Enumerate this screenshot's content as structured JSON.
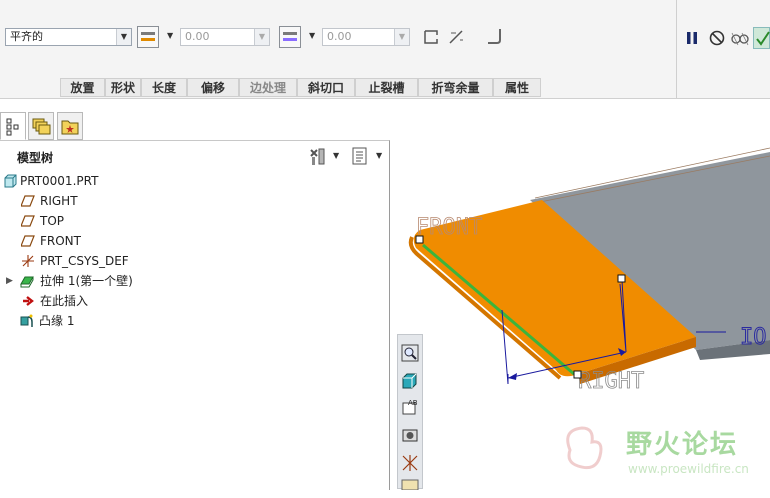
{
  "dashboard": {
    "alignment_select": "平齐的",
    "offset_value_1": "0.00",
    "offset_value_2": "0.00",
    "tabs": [
      "放置",
      "形状",
      "长度",
      "偏移",
      "边处理",
      "斜切口",
      "止裂槽",
      "折弯余量",
      "属性"
    ],
    "right_icons": [
      "pause-icon",
      "stop-icon",
      "glasses-preview-icon",
      "verify-icon"
    ]
  },
  "left_panel": {
    "tabs": [
      "model-tree-icon",
      "layers-icon",
      "favorites-folder-icon"
    ],
    "title": "模型树",
    "tree": [
      {
        "label": "PRT0001.PRT",
        "icon": "part-icon"
      },
      {
        "label": "RIGHT",
        "icon": "datum-plane-icon"
      },
      {
        "label": "TOP",
        "icon": "datum-plane-icon"
      },
      {
        "label": "FRONT",
        "icon": "datum-plane-icon"
      },
      {
        "label": "PRT_CSYS_DEF",
        "icon": "csys-icon"
      },
      {
        "label": "拉伸 1(第一个壁)",
        "icon": "extrude-icon"
      },
      {
        "label": "在此插入",
        "icon": "insert-arrow-icon"
      },
      {
        "label": "凸缘 1",
        "icon": "flange-icon"
      }
    ]
  },
  "graphics": {
    "labels": {
      "front": "FRONT",
      "right": "RIGHT",
      "top_partial": "IO"
    },
    "colors": {
      "preview": "#f08c00",
      "wall": "#8f969d",
      "edge": "#3cb43c",
      "csys": "#1a1a9e"
    }
  },
  "view_toolbar": [
    "zoom-icon",
    "shaded-view-icon",
    "named-view-icon",
    "render-icon",
    "datum-display-icon",
    "more-icon"
  ],
  "watermark": {
    "title": "野火论坛",
    "url": "www.proewildfire.cn"
  }
}
